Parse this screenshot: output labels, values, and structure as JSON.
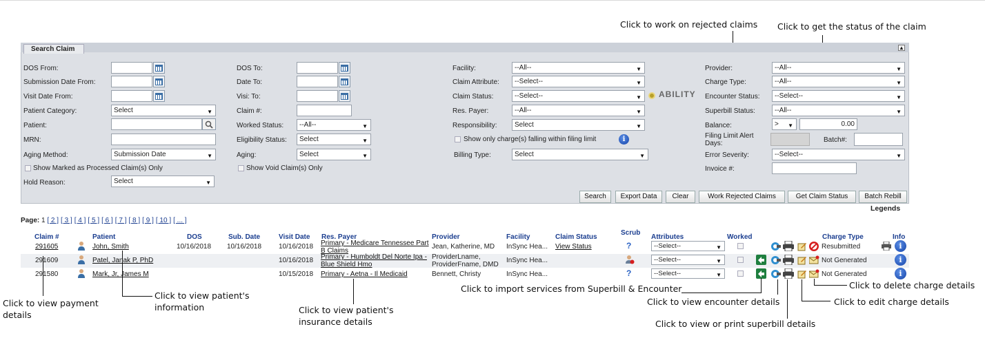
{
  "callouts": {
    "rejected": "Click to work on rejected claims",
    "status": "Click to get the status of the claim",
    "payment": "Click to view payment\ndetails",
    "patient": "Click to view patient's\ninformation",
    "insurance": "Click to view patient's\ninsurance details",
    "import": "Click to import services from Superbill & Encounter",
    "encounter": "Click to view encounter details",
    "superbill": "Click to view or print superbill details",
    "delete": "Click to delete charge details",
    "edit": "Click to edit charge details"
  },
  "panel": {
    "title": "Search Claim",
    "collapse_icon": "collapse-icon"
  },
  "form": {
    "dos_from": "DOS From:",
    "submission_date_from": "Submission Date From:",
    "visit_date_from": "Visit Date From:",
    "patient_category": "Patient Category:",
    "patient_category_value": "Select",
    "patient": "Patient:",
    "mrn": "MRN:",
    "aging_method": "Aging Method:",
    "aging_method_value": "Submission Date",
    "show_processed": "Show Marked as Processed Claim(s) Only",
    "hold_reason": "Hold Reason:",
    "hold_reason_value": "Select",
    "dos_to": "DOS To:",
    "date_to": "Date To:",
    "visit_to": "Visi: To:",
    "claim_no": "Claim #:",
    "worked_status": "Worked Status:",
    "worked_status_value": "--All--",
    "eligibility_status": "Eligibility Status:",
    "eligibility_status_value": "Select",
    "aging": "Aging:",
    "aging_value": "Select",
    "show_void": "Show Void Claim(s) Only",
    "facility": "Facility:",
    "facility_value": "--All--",
    "claim_attribute": "Claim Attribute:",
    "claim_attribute_value": "--Select--",
    "claim_status": "Claim Status:",
    "claim_status_value": "--Select--",
    "ability_logo": "ABILITY",
    "res_payer": "Res. Payer:",
    "res_payer_value": "--All--",
    "responsibility": "Responsibility:",
    "responsibility_value": "Select",
    "filing_limit": "Show only charge(s) falling within filing limit",
    "billing_type": "Billing Type:",
    "billing_type_value": "Select",
    "provider": "Provider:",
    "provider_value": "--All--",
    "charge_type": "Charge Type:",
    "charge_type_value": "--All--",
    "encounter_status": "Encounter Status:",
    "encounter_status_value": "--Select--",
    "superbill_status": "Superbill Status:",
    "superbill_status_value": "--All--",
    "balance": "Balance:",
    "balance_op": ">",
    "balance_value": "0.00",
    "filing_limit_alert": "Filing Limit Alert\nDays:",
    "batch": "Batch#:",
    "error_severity": "Error Severity:",
    "error_severity_value": "--Select--",
    "invoice": "Invoice #:"
  },
  "buttons": {
    "search": "Search",
    "export": "Export Data",
    "clear": "Clear",
    "work_rejected": "Work Rejected Claims",
    "claim_status": "Get Claim Status",
    "batch_rebill": "Batch Rebill"
  },
  "legends": "Legends",
  "pager": {
    "label": "Page:",
    "current": "1",
    "pages": [
      "[ 2 ]",
      "[ 3 ]",
      "[ 4 ]",
      "[ 5 ]",
      "[ 6 ]",
      "[ 7 ]",
      "[ 8 ]",
      "[ 9 ]",
      "[ 10 ]",
      "[ ... ]"
    ]
  },
  "table": {
    "headers": {
      "claim": "Claim #",
      "patient": "Patient",
      "dos": "DOS",
      "sub_date": "Sub. Date",
      "visit_date": "Visit Date",
      "res_payer": "Res. Payer",
      "provider": "Provider",
      "facility": "Facility",
      "claim_status": "Claim Status",
      "scrub": "Scrub",
      "attributes": "Attributes",
      "worked": "Worked",
      "charge_type": "Charge Type",
      "info": "Info"
    },
    "rows": [
      {
        "claim": "291605",
        "patient": "John, Smith",
        "dos": "10/16/2018",
        "sub_date": "10/16/2018",
        "visit_date": "10/16/2018",
        "payer1": "Primary - Medicare Tennessee Part",
        "payer2": "B Claims",
        "provider1": "Jean, Katherine, MD",
        "provider2": "",
        "facility": "InSync Hea...",
        "claim_status": "View Status",
        "attribute": "--Select--",
        "charge_type": "Resubmitted"
      },
      {
        "claim": "291609",
        "patient": "Patel, Janak P, PhD",
        "dos": "",
        "sub_date": "",
        "visit_date": "10/16/2018",
        "payer1": "Primary - Humboldt Del Norte Ipa -",
        "payer2": "Blue Shield Hmo",
        "provider1": "ProviderLname,",
        "provider2": "ProviderFname, DMD",
        "facility": "InSync Hea...",
        "claim_status": "",
        "attribute": "--Select--",
        "charge_type": "Not Generated"
      },
      {
        "claim": "291580",
        "patient": "Mark, Jr, James M",
        "dos": "",
        "sub_date": "",
        "visit_date": "10/15/2018",
        "payer1": "Primary - Aetna - Il Medicaid",
        "payer2": "",
        "provider1": "Bennett, Christy",
        "provider2": "",
        "facility": "InSync Hea...",
        "claim_status": "",
        "attribute": "--Select--",
        "charge_type": "Not Generated"
      }
    ]
  },
  "colors": {
    "panel_bg": "#dde0e5",
    "header_text": "#1a3d8f",
    "info_blue": "#1443a8"
  }
}
